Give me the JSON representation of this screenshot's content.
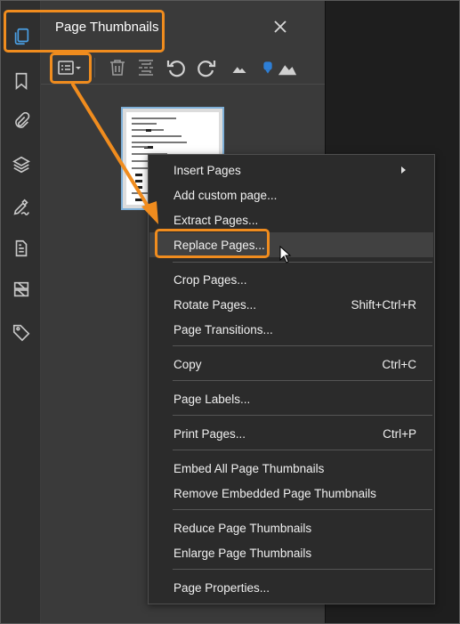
{
  "panel": {
    "title": "Page Thumbnails",
    "close_glyph": "✕"
  },
  "left_rail": {
    "items": [
      {
        "icon": "page-thumbnails-icon",
        "active": true
      },
      {
        "icon": "bookmark-icon"
      },
      {
        "icon": "attachment-icon"
      },
      {
        "icon": "layers-icon"
      },
      {
        "icon": "signature-icon"
      },
      {
        "icon": "document-icon"
      },
      {
        "icon": "compare-icon"
      },
      {
        "icon": "tag-icon"
      }
    ]
  },
  "toolbar": {
    "items": [
      "options-menu-icon",
      "delete-icon",
      "insert-page-icon",
      "rotate-ccw-icon",
      "rotate-cw-icon",
      "zoom-out-icon",
      "zoom-slider-icon",
      "zoom-in-icon"
    ]
  },
  "menu": {
    "items": [
      {
        "label": "Insert Pages",
        "shortcut": "",
        "submenu": true
      },
      {
        "label": "Add custom page...",
        "shortcut": ""
      },
      {
        "label": "Extract Pages...",
        "shortcut": ""
      },
      {
        "label": "Replace Pages...",
        "shortcut": "",
        "highlighted": true
      },
      {
        "label": "Crop Pages...",
        "shortcut": ""
      },
      {
        "label": "Rotate Pages...",
        "shortcut": "Shift+Ctrl+R"
      },
      {
        "label": "Page Transitions...",
        "shortcut": ""
      },
      {
        "label": "Copy",
        "shortcut": "Ctrl+C"
      },
      {
        "label": "Page Labels...",
        "shortcut": ""
      },
      {
        "label": "Print Pages...",
        "shortcut": "Ctrl+P"
      },
      {
        "label": "Embed All Page Thumbnails",
        "shortcut": ""
      },
      {
        "label": "Remove Embedded Page Thumbnails",
        "shortcut": ""
      },
      {
        "label": "Reduce Page Thumbnails",
        "shortcut": ""
      },
      {
        "label": "Enlarge Page Thumbnails",
        "shortcut": ""
      },
      {
        "label": "Page Properties...",
        "shortcut": ""
      }
    ]
  },
  "colors": {
    "highlight": "#f08c1e",
    "accent": "#4aa0e6",
    "menu_bg": "#2b2b2b",
    "panel_bg": "#3a3a3a"
  }
}
